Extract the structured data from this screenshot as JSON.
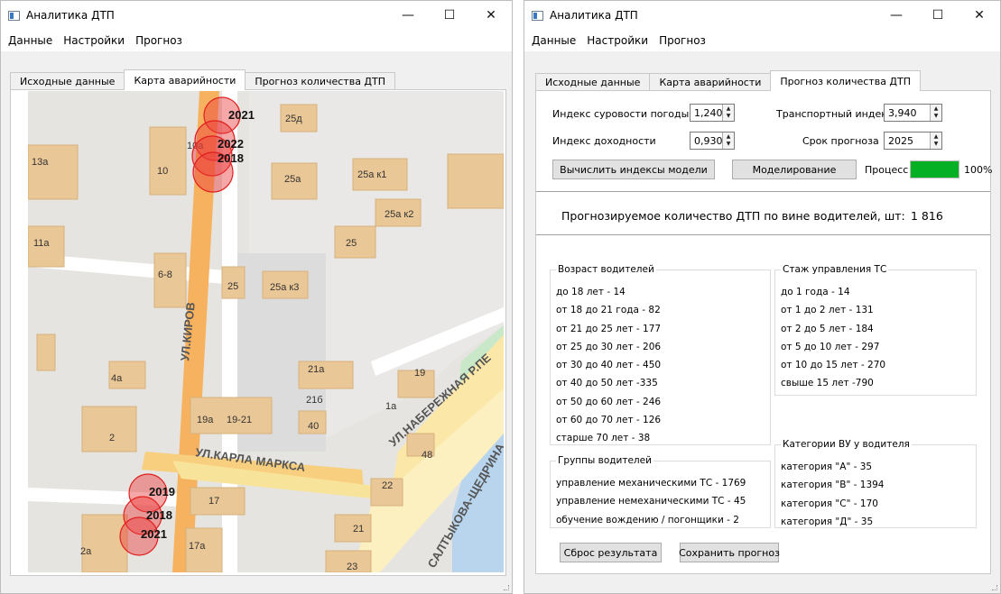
{
  "left_window": {
    "title": "Аналитика ДТП",
    "menu": [
      "Данные",
      "Настройки",
      "Прогноз"
    ],
    "tabs": [
      "Исходные данные",
      "Карта аварийности",
      "Прогноз количества ДТП"
    ],
    "active_tab": 1,
    "map": {
      "street_labels": [
        "УЛ.КИРОВ",
        "УЛ.КАРЛА МАРКСА",
        "УЛ.НАБЕРЕЖНАЯ Р.ПЕ",
        "САЛТЫКОВА-ЩЕДРИНА"
      ],
      "building_labels": [
        "25д",
        "10а",
        "13а",
        "10",
        "25а",
        "25а к1",
        "25а к2",
        "11а",
        "25",
        "6-8",
        "25",
        "25а к3",
        "4а",
        "21а",
        "19",
        "21б",
        "1а",
        "19а",
        "19-21",
        "40",
        "2",
        "48",
        "22",
        "17",
        "2а",
        "17а",
        "21",
        "23"
      ],
      "accident_years_top": [
        "2021",
        "2022",
        "2018"
      ],
      "accident_years_bottom": [
        "2019",
        "2018",
        "2021"
      ]
    }
  },
  "right_window": {
    "title": "Аналитика ДТП",
    "menu": [
      "Данные",
      "Настройки",
      "Прогноз"
    ],
    "tabs": [
      "Исходные данные",
      "Карта аварийности",
      "Прогноз количества ДТП"
    ],
    "active_tab": 2,
    "inputs": {
      "weather_label": "Индекс суровости погоды",
      "weather_value": "1,240",
      "transport_label": "Транспортный индекс",
      "transport_value": "3,940",
      "income_label": "Индекс доходности",
      "income_value": "0,930",
      "term_label": "Срок прогноза",
      "term_value": "2025"
    },
    "buttons": {
      "compute": "Вычислить индексы модели",
      "model": "Моделирование",
      "reset": "Сброс результата",
      "save": "Сохранить прогноз"
    },
    "process_label": "Процесс",
    "progress_text": "100%",
    "progress_value": 1.0,
    "progress_color": "#06b025",
    "forecast_label": "Прогнозируемое количество ДТП по вине водителей, шт:",
    "forecast_value": "1 816",
    "groups": {
      "age": {
        "title": "Возраст водителей",
        "items": [
          "до 18 лет - 14",
          "от 18 до 21 года - 82",
          "от 21 до 25 лет - 177",
          "от 25 до 30 лет - 206",
          "от 30 до 40 лет - 450",
          "от 40 до 50 лет -335",
          "от 50 до 60 лет - 246",
          "от 60 до 70 лет - 126",
          "старше 70 лет - 38"
        ]
      },
      "experience": {
        "title": "Стаж управления ТС",
        "items": [
          "до 1 года - 14",
          "от 1 до 2 лет - 131",
          "от 2 до 5 лет - 184",
          "от 5 до 10 лет - 297",
          "от 10 до 15 лет - 270",
          "свыше 15 лет -790"
        ]
      },
      "driver_groups": {
        "title": "Группы водителей",
        "items": [
          "управление механическими ТС - 1769",
          "управление немеханическими ТС - 45",
          "обучение вождению / погонщики - 2"
        ]
      },
      "license": {
        "title": "Категории ВУ у водителя",
        "items": [
          "категория \"А\" - 35",
          "категория \"В\" - 1394",
          "категория \"С\" - 170",
          "категория \"Д\" - 35"
        ]
      }
    }
  }
}
